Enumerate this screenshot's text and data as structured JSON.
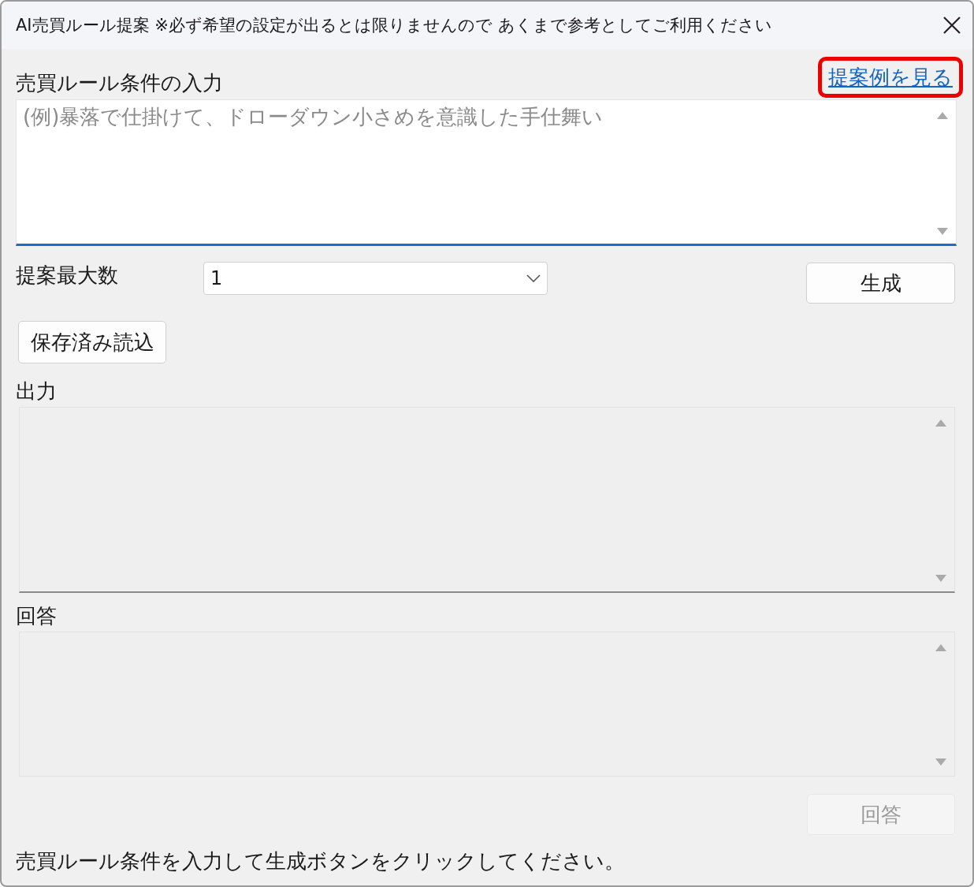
{
  "window": {
    "title": "AI売買ルール提案 ※必ず希望の設定が出るとは限りませんので あくまで参考としてご利用ください"
  },
  "input": {
    "label": "売買ルール条件の入力",
    "placeholder": "(例)暴落で仕掛けて、ドローダウン小さめを意識した手仕舞い"
  },
  "example_link": {
    "label": "提案例を見る",
    "highlighted": true
  },
  "max_count": {
    "label": "提案最大数",
    "value": "1"
  },
  "generate_button": {
    "label": "生成",
    "disabled": false
  },
  "load_saved_button": {
    "label": "保存済み読込",
    "disabled": false
  },
  "output": {
    "label": "出力",
    "disabled": true
  },
  "answer": {
    "label": "回答",
    "disabled": true
  },
  "answer_button": {
    "label": "回答",
    "disabled": true
  },
  "status": "売買ルール条件を入力して生成ボタンをクリックしてください。"
}
